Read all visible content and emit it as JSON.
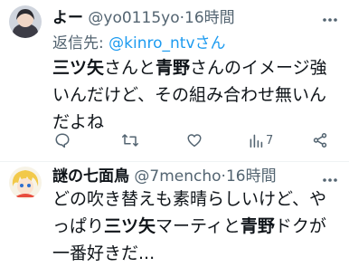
{
  "tweets": [
    {
      "name": "よー",
      "handle": "@yo0115yo",
      "separator": "·",
      "time": "16時間",
      "reply_prefix": "返信先:",
      "reply_mention": "@kinro_ntvさん",
      "body": {
        "line1_a": "三ツ矢",
        "line1_b": "さんと",
        "line1_c": "青野",
        "line1_d": "さんのイメージ強",
        "line2": "いんだけど、その組み合わせ無いん",
        "line3": "だよね"
      },
      "actions": {
        "views_count": "7"
      }
    },
    {
      "name": "謎の七面鳥",
      "handle": "@7mencho",
      "separator": "·",
      "time": "16時間",
      "body": {
        "line1": "どの吹き替えも素晴らしいけど、や",
        "line2_a": "っぱり",
        "line2_b": "三ツ矢",
        "line2_c": "マーティと",
        "line2_d": "青野",
        "line2_e": "ドクが",
        "line3": "一番好きだ..."
      }
    }
  ],
  "icons": {
    "reply": "reply-icon",
    "retweet": "retweet-icon",
    "like": "like-icon",
    "views": "views-icon",
    "share": "share-icon",
    "more": "more-icon"
  }
}
